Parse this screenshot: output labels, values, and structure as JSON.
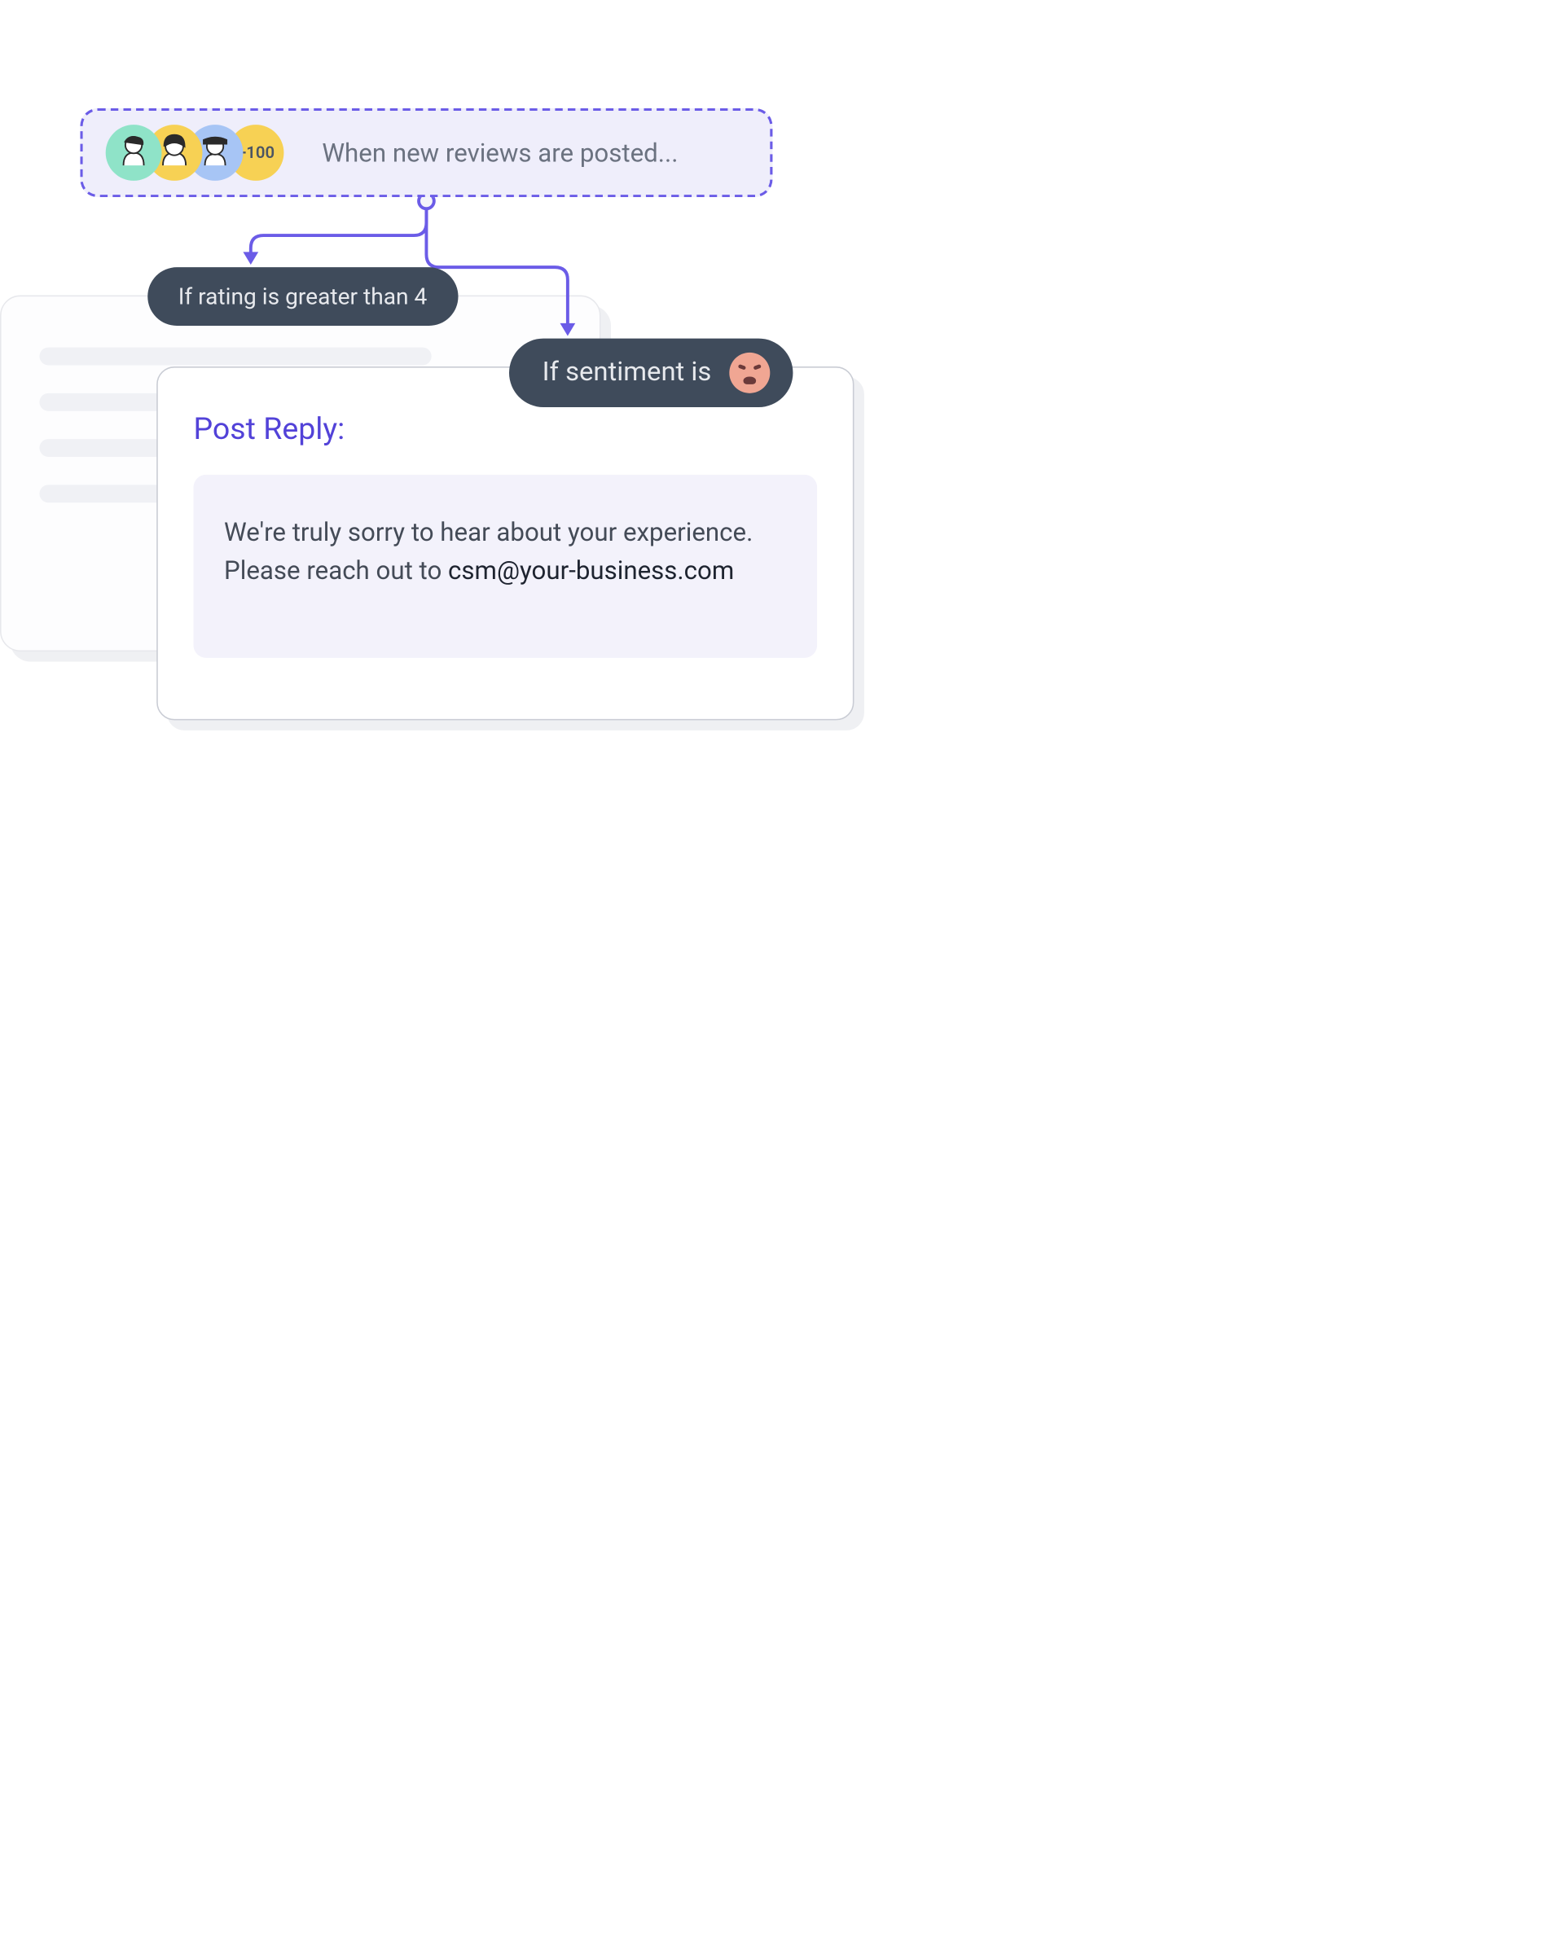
{
  "trigger": {
    "label": "When new reviews are posted...",
    "extra_count": "+100"
  },
  "conditions": {
    "rating": "If rating is greater than 4",
    "sentiment_prefix": "If sentiment is"
  },
  "reply": {
    "title": "Post Reply:",
    "body_prefix": "We're truly sorry to hear about your experience. Please reach out to ",
    "email": "csm@your-business.com"
  },
  "colors": {
    "dashed_border": "#6B5CE7",
    "trigger_bg": "#EFEEFB",
    "pill_bg": "#3F4B5B",
    "accent_text": "#5242D8",
    "reply_bg": "#F3F2FB"
  }
}
